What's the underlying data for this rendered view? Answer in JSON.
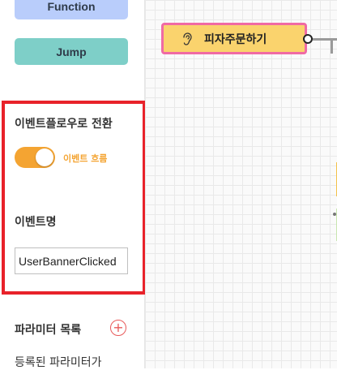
{
  "palette": {
    "function_label": "Function",
    "jump_label": "Jump"
  },
  "event_flow": {
    "title": "이벤트플로우로 전환",
    "toggle_on": true,
    "toggle_label": "이벤트 흐름"
  },
  "event_name": {
    "title": "이벤트명",
    "value": "UserBannerClicked"
  },
  "parameters": {
    "title": "파라미터 목록",
    "add_icon": "+",
    "empty_text": "등록된 파라미터가"
  },
  "canvas": {
    "node_label": "피자주문하기",
    "node_icon": "ear-icon"
  },
  "colors": {
    "highlight": "#e8222a",
    "toggle": "#f4a432",
    "node_fill": "#fad36d",
    "node_border": "#f06aa4"
  }
}
